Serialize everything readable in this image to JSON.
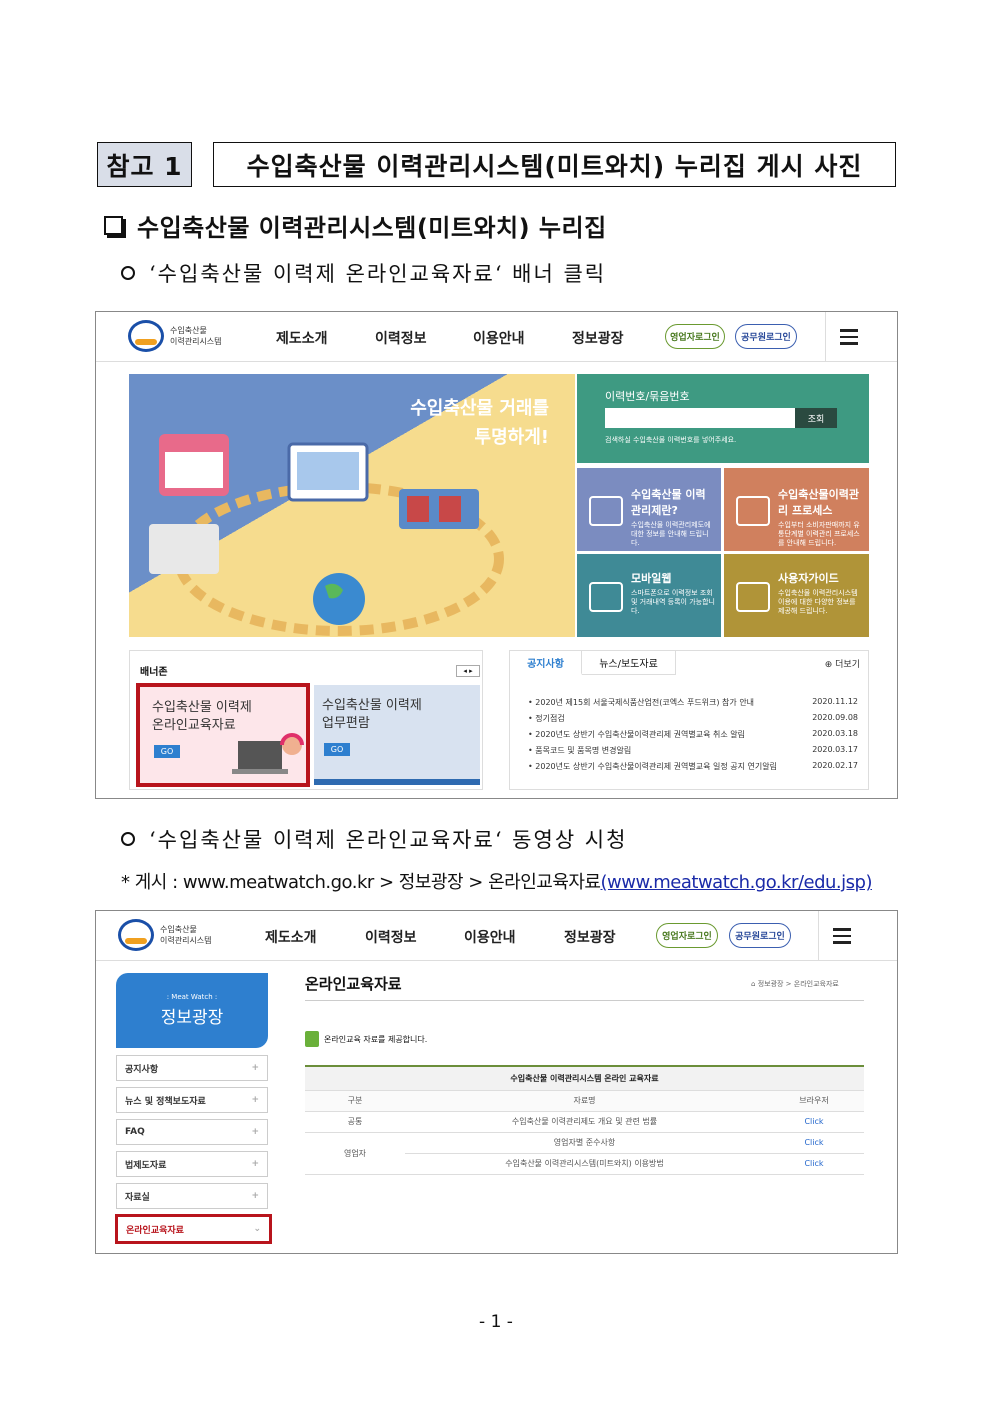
{
  "ref": {
    "label": "참고 1",
    "title": "수입축산물 이력관리시스템(미트와치) 누리집 게시 사진"
  },
  "section": {
    "title": "수입축산물 이력관리시스템(미트와치) 누리집"
  },
  "bullets": [
    "‘수입축산물 이력제 온라인교육자료‘ 배너 클릭",
    "‘수입축산물 이력제 온라인교육자료‘ 동영상 시청"
  ],
  "note": {
    "prefix": "* 게시 : www.meatwatch.go.kr > 정보광장 > 온라인교육자료",
    "url": "(www.meatwatch.go.kr/edu.jsp)"
  },
  "site": {
    "logo_line1": "수입축산물",
    "logo_line2": "이력관리시스템",
    "nav": [
      "제도소개",
      "이력정보",
      "이용안내",
      "정보광장"
    ],
    "btn_business": "영업자로그인",
    "btn_official": "공무원로그인"
  },
  "shot1": {
    "hero_line1": "수입축산물 거래를",
    "hero_line2": "투명하게!",
    "search_label": "이력번호/묶음번호",
    "search_btn": "조회",
    "search_hint": "검색하실 수입축산물 이력번호를 넣어주세요.",
    "tiles": [
      {
        "title": "수입축산물 이력관리제란?",
        "desc": "수입축산물 이력관리제도에 대한 정보를 안내해 드립니다."
      },
      {
        "title": "수입축산물이력관리 프로세스",
        "desc": "수입부터 소비자판매까지 유통단계별 이력관리 프로세스를 안내해 드립니다."
      },
      {
        "title": "모바일웹",
        "desc": "스마트폰으로 이력정보 조회 및 거래내역 등록이 가능합니다."
      },
      {
        "title": "사용자가이드",
        "desc": "수입축산물 이력관리시스템 이용에 대한 다양한 정보를 제공해 드립니다."
      }
    ],
    "banner_zone": "배너존",
    "banner1_l1": "수입축산물 이력제",
    "banner1_l2": "온라인교육자료",
    "banner2_l1": "수입축산물 이력제",
    "banner2_l2": "업무편람",
    "go": "GO",
    "tab_notice": "공지사항",
    "tab_news": "뉴스/보도자료",
    "more": "더보기",
    "news": [
      {
        "t": "2020년 제15회 서울국제식품산업전(코엑스 푸드위크) 참가 안내",
        "d": "2020.11.12"
      },
      {
        "t": "정기점검",
        "d": "2020.09.08"
      },
      {
        "t": "2020년도 상반기 수입축산물이력관리제 권역별교육 취소 알림",
        "d": "2020.03.18"
      },
      {
        "t": "품목코드 및 품목명 변경알림",
        "d": "2020.03.17"
      },
      {
        "t": "2020년도 상반기 수입축산물이력관리제 권역별교육 일정 공지 연기알림",
        "d": "2020.02.17"
      }
    ]
  },
  "shot2": {
    "side_small": ": Meat Watch :",
    "side_title": "정보광장",
    "side_items": [
      "공지사항",
      "뉴스 및 정책보도자료",
      "FAQ",
      "법제도자료",
      "자료실",
      "온라인교육자료"
    ],
    "page_title": "온라인교육자료",
    "breadcrumb": "정보광장 > 온라인교육자료",
    "intro": "온라인교육 자료를 제공합니다.",
    "table_title": "수입축산물 이력관리시스템 온라인 교육자료",
    "col_type": "구분",
    "col_name": "자료명",
    "col_browser": "브라우저",
    "rows": [
      {
        "type": "공통",
        "name": "수입축산물 이력관리제도 개요 및 관련 법률",
        "link": "Click"
      },
      {
        "type": "영업자",
        "name": "영업자별 준수사항",
        "link": "Click"
      },
      {
        "type": "",
        "name": "수입축산물 이력관리시스템(미트와치) 이용방법",
        "link": "Click"
      }
    ]
  },
  "page": "- 1 -"
}
